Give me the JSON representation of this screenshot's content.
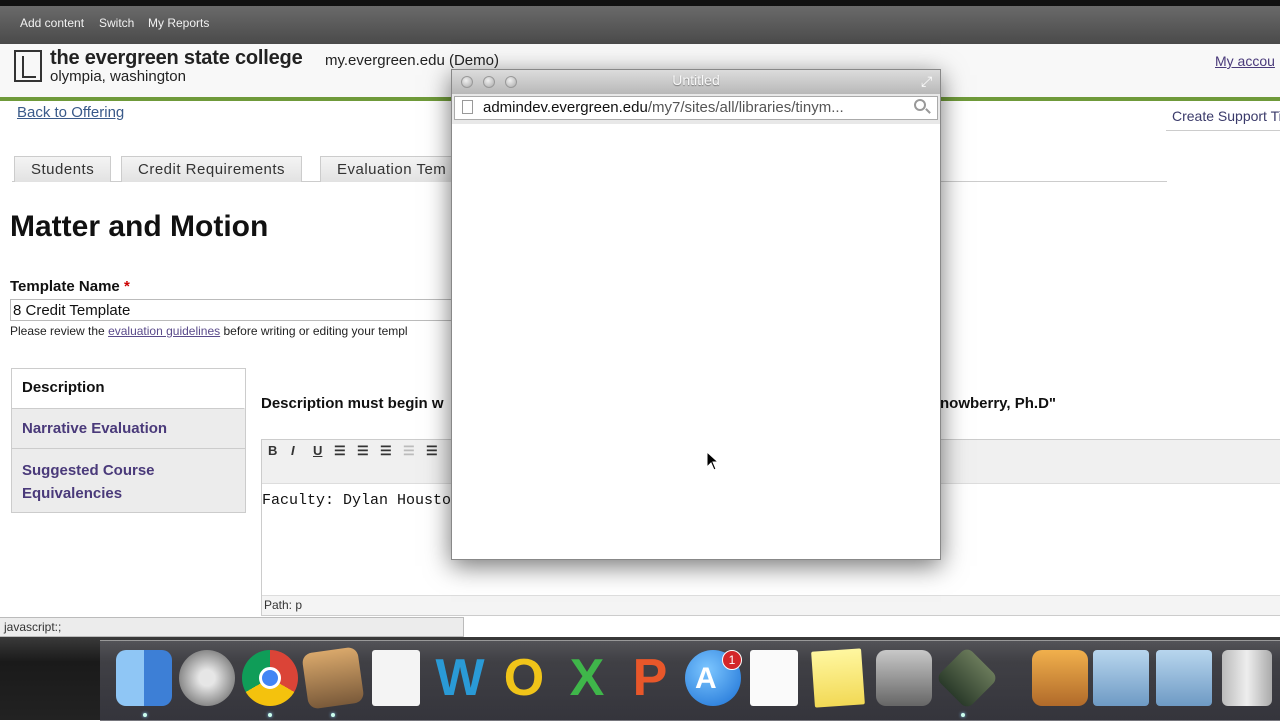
{
  "admin_bar": {
    "items": [
      "Add content",
      "Switch",
      "My Reports"
    ]
  },
  "header": {
    "college_line1": "the evergreen state college",
    "college_line2": "olympia, washington",
    "site_name": "my.evergreen.edu (Demo)",
    "account_link": "My accou"
  },
  "nav": {
    "back": "Back to Offering",
    "support": "Create Support Tic"
  },
  "tabs": [
    "Students",
    "Credit Requirements",
    "Evaluation Tem"
  ],
  "page": {
    "title": "Matter and Motion",
    "template_label": "Template Name",
    "required_mark": "*",
    "template_value": "8 Credit Template",
    "review_prefix": "Please review the ",
    "review_link": "evaluation guidelines",
    "review_suffix": " before writing or editing your templ"
  },
  "vertical_tabs": [
    "Description",
    "Narrative Evaluation",
    "Suggested Course Equivalencies"
  ],
  "editor": {
    "instruction_left": "Description must begin w",
    "instruction_right": "nowberry, Ph.D\"",
    "content": "Faculty: Dylan Houston,",
    "path": "Path: p",
    "toolbar_buttons": [
      "bold-icon",
      "italic-icon",
      "underline-icon",
      "align-left-icon",
      "align-center-icon",
      "align-right-icon",
      "outdent-icon",
      "indent-icon"
    ]
  },
  "status_bar": "javascript:;",
  "popup": {
    "title": "Untitled",
    "url_host": "admindev.evergreen.edu",
    "url_path": "/my7/sites/all/libraries/tinym..."
  },
  "dock": {
    "apps": [
      "finder-icon",
      "launchpad-icon",
      "chrome-icon",
      "iphoto-icon",
      "document-icon",
      "word-icon",
      "outlook-icon",
      "excel-icon",
      "powerpoint-icon",
      "app-store-icon",
      "reminders-icon",
      "stickies-icon",
      "remote-desktop-icon",
      "xcode-icon",
      "preview-icon",
      "applications-folder-icon",
      "downloads-folder-icon",
      "trash-icon"
    ],
    "app_store_badge": "1"
  },
  "colors": {
    "accent_green": "#6f9a3a",
    "link_purple": "#5a4a8a"
  }
}
